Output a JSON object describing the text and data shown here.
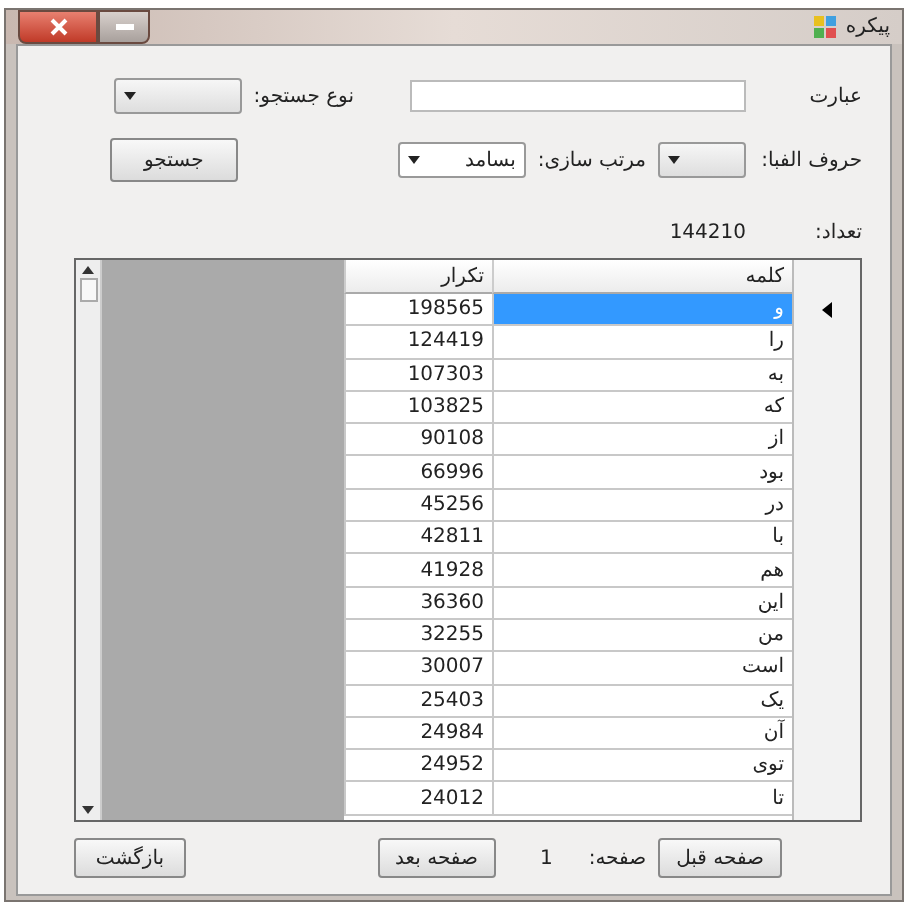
{
  "window": {
    "title": "پیکره"
  },
  "form": {
    "phrase_label": "عبارت",
    "search_type_label": "نوع جستجو:",
    "alphabet_label": "حروف الفبا:",
    "sort_label": "مرتب سازی:",
    "sort_value": "بسامد",
    "search_button": "جستجو",
    "count_label": "تعداد:",
    "count_value": "144210"
  },
  "table": {
    "columns": [
      "کلمه",
      "تکرار"
    ],
    "rows": [
      {
        "word": "و",
        "count": "198565",
        "selected": true
      },
      {
        "word": "را",
        "count": "124419",
        "selected": false
      },
      {
        "word": "به",
        "count": "107303",
        "selected": false
      },
      {
        "word": "که",
        "count": "103825",
        "selected": false
      },
      {
        "word": "از",
        "count": "90108",
        "selected": false
      },
      {
        "word": "بود",
        "count": "66996",
        "selected": false
      },
      {
        "word": "در",
        "count": "45256",
        "selected": false
      },
      {
        "word": "با",
        "count": "42811",
        "selected": false
      },
      {
        "word": "هم",
        "count": "41928",
        "selected": false
      },
      {
        "word": "این",
        "count": "36360",
        "selected": false
      },
      {
        "word": "من",
        "count": "32255",
        "selected": false
      },
      {
        "word": "است",
        "count": "30007",
        "selected": false
      },
      {
        "word": "یک",
        "count": "25403",
        "selected": false
      },
      {
        "word": "آن",
        "count": "24984",
        "selected": false
      },
      {
        "word": "توی",
        "count": "24952",
        "selected": false
      },
      {
        "word": "تا",
        "count": "24012",
        "selected": false
      }
    ]
  },
  "pager": {
    "prev_button": "صفحه قبل",
    "page_label": "صفحه:",
    "page_value": "1",
    "next_button": "صفحه بعد",
    "back_button": "بازگشت"
  }
}
